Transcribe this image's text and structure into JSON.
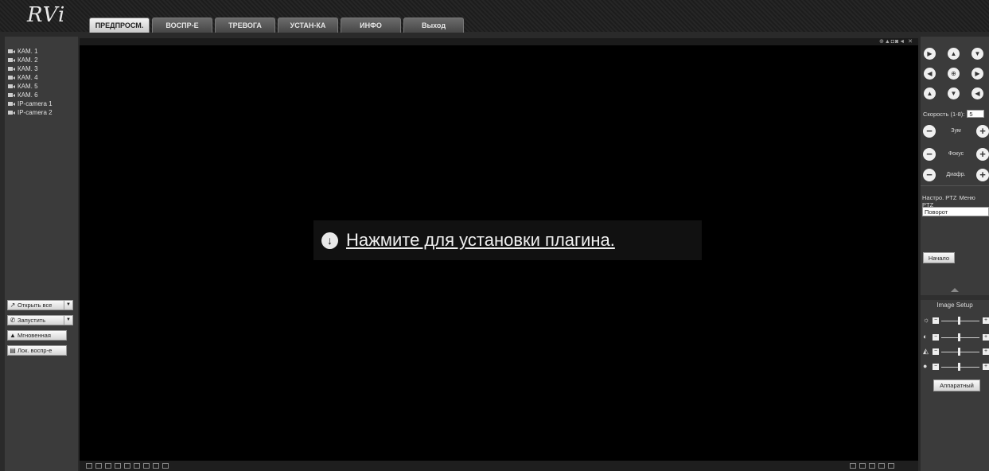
{
  "brand": {
    "logo": "RVi"
  },
  "nav": {
    "tabs": [
      {
        "label": "ПРЕДПРОСМ.",
        "active": true
      },
      {
        "label": "ВОСПР-Е"
      },
      {
        "label": "ТРЕВОГА"
      },
      {
        "label": "УСТАН-КА"
      },
      {
        "label": "ИНФО"
      },
      {
        "label": "Выход"
      }
    ]
  },
  "cameras": [
    "КАМ. 1",
    "КАМ. 2",
    "КАМ. 3",
    "КАМ. 4",
    "КАМ. 5",
    "КАМ. 6",
    "IP-camera 1",
    "IP-camera 2"
  ],
  "left_buttons": {
    "open_all": "Открыть все",
    "start": "Запустить",
    "snapshot": "Мгновенная",
    "local_play": "Лок. воспр-е"
  },
  "video": {
    "toolbar_icons": "⊕▲◘◙◄ ✕",
    "plugin_text": "Нажмите для установки плагина."
  },
  "ptz": {
    "speed_label": "Скорость (1-8):",
    "speed_value": "5",
    "zoom_label": "Зум",
    "focus_label": "Фокус",
    "iris_label": "Диафр.",
    "tab_setup": "Настро. PTZ",
    "tab_menu": "Меню PTZ",
    "mode_value": "Поворот",
    "start_label": "Начало"
  },
  "image_setup": {
    "title": "Image Setup",
    "hardware_label": "Аппаратный"
  },
  "colors": {
    "background": "#2a2a2a",
    "panel": "#3b3b3b",
    "video": "#000000"
  }
}
